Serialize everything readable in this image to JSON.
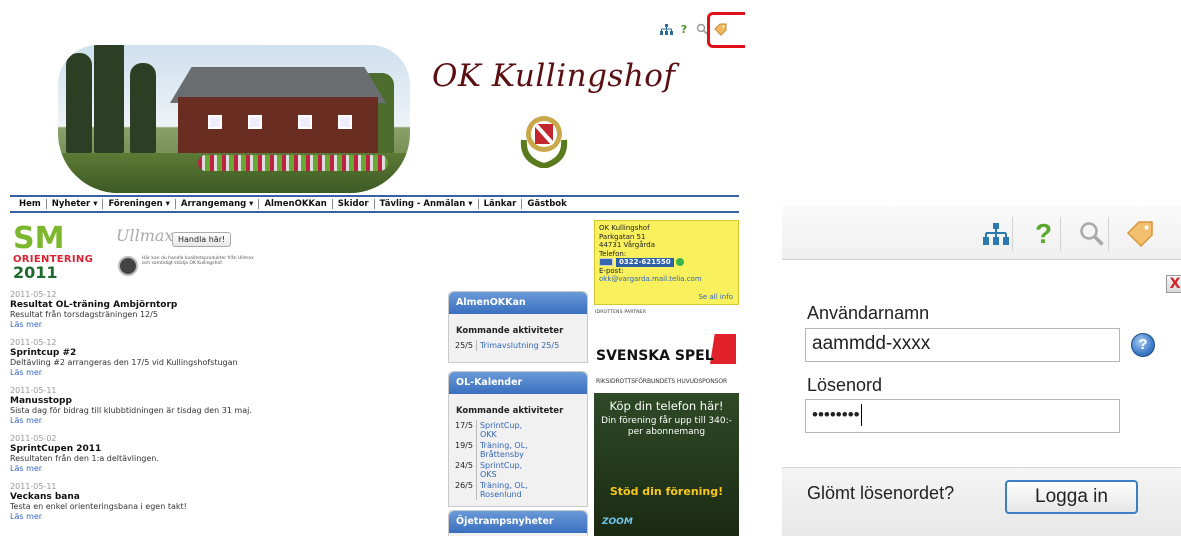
{
  "site": {
    "title": "OK Kullingshof",
    "nav": [
      "Hem",
      "Nyheter ▾",
      "Föreningen ▾",
      "Arrangemang ▾",
      "AlmenOKKan",
      "Skidor",
      "Tävling - Anmälan ▾",
      "Länkar",
      "Gästbok"
    ],
    "sm_logo": {
      "top": "SM",
      "middle": "ORIENTERING",
      "year": "2011"
    },
    "ullmax": {
      "brand": "Ullmax",
      "button": "Handla här!",
      "blurb": "Här kan du handla kvalitetsprodukter från Ullmax och samtidigt stödja OK Kullingshof."
    },
    "news": [
      {
        "date": "2011-05-12",
        "title": "Resultat OL-träning Ambjörntorp",
        "text": "Resultat från torsdagsträningen 12/5",
        "more": "Läs mer"
      },
      {
        "date": "2011-05-12",
        "title": "Sprintcup #2",
        "text": "Deltävling #2 arrangeras den 17/5 vid Kullingshofstugan",
        "more": "Läs mer"
      },
      {
        "date": "2011-05-11",
        "title": "Manusstopp",
        "text": "Sista dag för bidrag till klubbtidningen är tisdag den 31 maj.",
        "more": "Läs mer"
      },
      {
        "date": "2011-05-02",
        "title": "SprintCupen 2011",
        "text": "Resultaten från den 1:a deltävlingen.",
        "more": "Läs mer"
      },
      {
        "date": "2011-05-11",
        "title": "Veckans bana",
        "text": "Testa en enkel orienteringsbana i egen takt!",
        "more": "Läs mer"
      }
    ],
    "almen": {
      "header": "AlmenOKKan",
      "sub": "Kommande aktiviteter",
      "rows": [
        {
          "date": "25/5",
          "activity": "Trimavslutning 25/5"
        }
      ]
    },
    "ol": {
      "header": "OL-Kalender",
      "sub": "Kommande aktiviteter",
      "rows": [
        {
          "date": "17/5",
          "activity": "SprintCup, OKK"
        },
        {
          "date": "19/5",
          "activity": "Träning, OL, Bråttensby"
        },
        {
          "date": "24/5",
          "activity": "SprintCup, OKS"
        },
        {
          "date": "26/5",
          "activity": "Träning, OL, Rosenlund"
        }
      ]
    },
    "ojetramp": {
      "header": "Öjetrampsnyheter"
    },
    "contact": {
      "name": "OK Kullingshof",
      "street": "Parkgatan 51",
      "city": "44731 Vårgårda",
      "phone_label": "Telefon:",
      "phone": "0322-621550",
      "email_label": "E-post:",
      "email": "okk@vargarda.mail.telia.com",
      "all": "Se all info"
    },
    "sponsor_label": "IDROTTENS PARTNER",
    "svenska_spel": {
      "name": "SVENSKA SPEL",
      "sub": "RIKSIDROTTSFÖRBUNDETS HUVUDSPONSOR"
    },
    "ad": {
      "line1": "Köp din telefon här!",
      "line2": "Din förening får upp till 340:- per abonnemang",
      "line3": "Stöd din förening!",
      "logo": "ZOOM"
    }
  },
  "login": {
    "username_label": "Användarnamn",
    "username_value": "aammdd-xxxx",
    "password_label": "Lösenord",
    "password_value": "••••••••",
    "forgot": "Glömt lösenordet?",
    "submit": "Logga in",
    "close": "X",
    "help": "?"
  },
  "colors": {
    "accent": "#3a6fbf",
    "highlight": "#e0101a",
    "contact_bg": "#f8f05c"
  }
}
